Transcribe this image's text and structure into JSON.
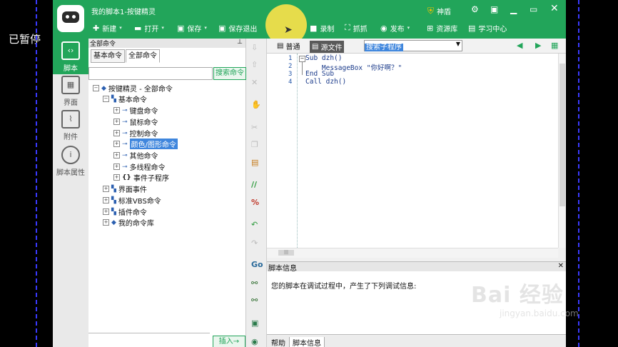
{
  "overlay": {
    "paused_text": "已暂停"
  },
  "watermark": {
    "brand": "Bai 经验",
    "url": "jingyan.baidu.com"
  },
  "window": {
    "title": "我的脚本1-按键精灵",
    "user": "神盾"
  },
  "toolbar": {
    "new": "新建",
    "open": "打开",
    "save": "保存",
    "save_exit": "保存退出",
    "record": "录制",
    "capture": "抓抓",
    "publish": "发布",
    "resource": "资源库",
    "learn": "学习中心"
  },
  "nav": {
    "script": "脚本",
    "ui": "界面",
    "attach": "附件",
    "props": "脚本属性"
  },
  "cmd_panel": {
    "header": "全部命令",
    "tab_basic": "基本命令",
    "tab_all": "全部命令",
    "search_btn": "搜索命令",
    "insert_btn": "插入→",
    "tree": {
      "root": "按键精灵 - 全部命令",
      "basic": "基本命令",
      "keyboard": "键盘命令",
      "mouse": "鼠标命令",
      "control": "控制命令",
      "color": "颜色/图形命令",
      "other": "其他命令",
      "multithread": "多线程命令",
      "event": "事件子程序",
      "ui_event": "界面事件",
      "vbs": "标准VBS命令",
      "plugin": "插件命令",
      "mylib": "我的命令库"
    }
  },
  "editor": {
    "tab_normal": "普通",
    "tab_source": "源文件",
    "proc_select": "搜索子程序",
    "lines": [
      "1",
      "2",
      "3",
      "4"
    ],
    "code": [
      "Sub dzh()",
      "    MessageBox \"你好啊？\"",
      "End Sub",
      "Call dzh()"
    ]
  },
  "info": {
    "header": "脚本信息",
    "message": "您的脚本在调试过程中，产生了下列调试信息:",
    "tab_help": "帮助",
    "tab_info": "脚本信息"
  },
  "colors": {
    "accent": "#22a55a",
    "selection": "#3f86dd"
  }
}
